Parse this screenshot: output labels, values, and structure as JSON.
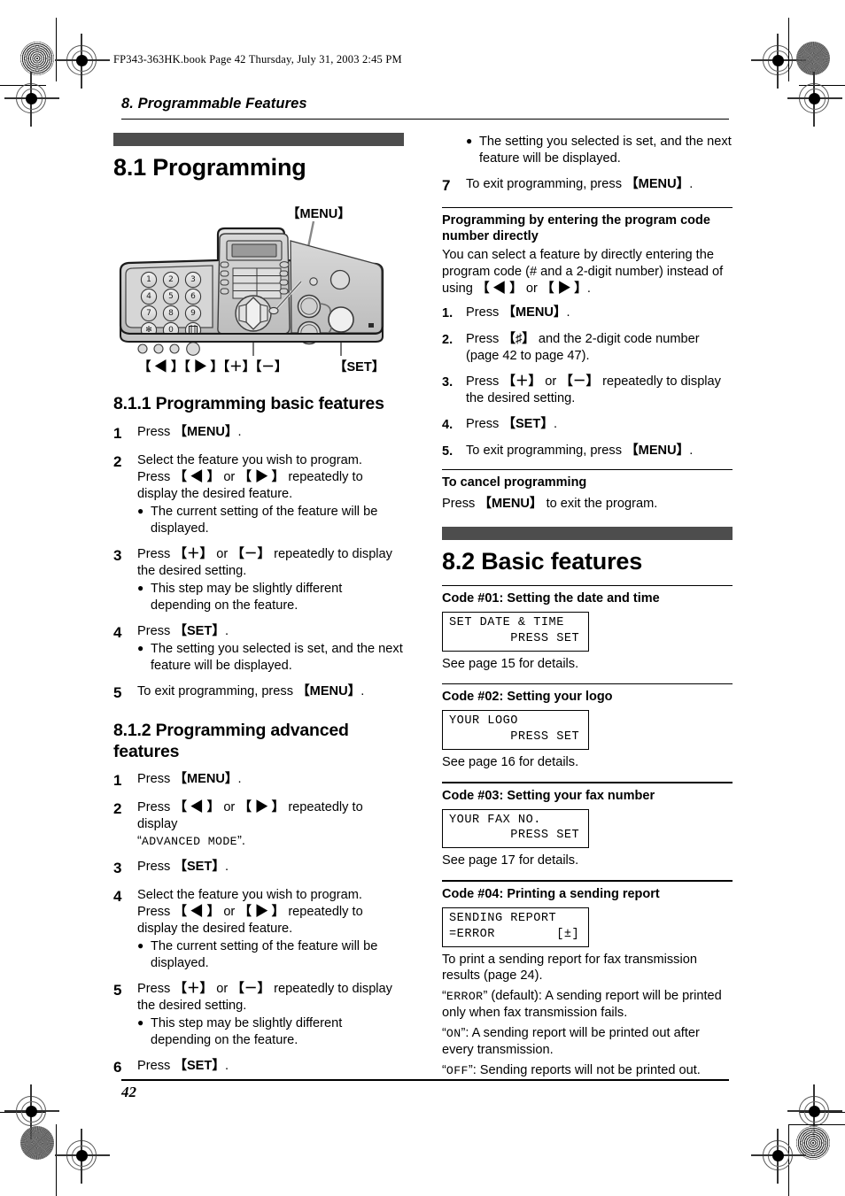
{
  "print_marks": {
    "note": "registration crosshairs and halftone dots"
  },
  "book_line": "FP343-363HK.book  Page 42  Thursday, July 31, 2003  2:45 PM",
  "running_head": "8. Programmable Features",
  "folio": "42",
  "left_column": {
    "section_title": "8.1 Programming",
    "figure": {
      "callout_menu": "【MENU】",
      "callout_nav": "【 ◀ 】【 ▶ 】【＋】【－】",
      "callout_set": "【SET】"
    },
    "subsection1": {
      "title": "8.1.1 Programming basic features",
      "steps": [
        {
          "num": "1",
          "text_parts": [
            "Press ",
            "【MENU】",
            "."
          ]
        },
        {
          "num": "2",
          "line1": "Select the feature you wish to program.",
          "line2_parts": [
            "Press ",
            "【 ◀ 】",
            " or ",
            "【 ▶ 】",
            " repeatedly to display the desired feature."
          ],
          "bullets": [
            "The current setting of the feature will be displayed."
          ]
        },
        {
          "num": "3",
          "line_parts": [
            "Press ",
            "【＋】",
            " or ",
            "【－】",
            " repeatedly to display the desired setting."
          ],
          "bullets": [
            "This step may be slightly different depending on the feature."
          ]
        },
        {
          "num": "4",
          "text_parts": [
            "Press ",
            "【SET】",
            "."
          ],
          "bullets": [
            "The setting you selected is set, and the next feature will be displayed."
          ]
        },
        {
          "num": "5",
          "text_parts": [
            "To exit programming, press ",
            "【MENU】",
            "."
          ]
        }
      ]
    },
    "subsection2": {
      "title": "8.1.2 Programming advanced features",
      "steps": [
        {
          "num": "1",
          "text_parts": [
            "Press ",
            "【MENU】",
            "."
          ]
        },
        {
          "num": "2",
          "line_parts": [
            "Press ",
            "【 ◀ 】",
            " or ",
            "【 ▶ 】",
            " repeatedly to display "
          ],
          "lcd_word": "ADVANCED MODE"
        },
        {
          "num": "3",
          "text_parts": [
            "Press ",
            "【SET】",
            "."
          ]
        },
        {
          "num": "4",
          "line1": "Select the feature you wish to program.",
          "line2_parts": [
            "Press ",
            "【 ◀ 】",
            " or ",
            "【 ▶ 】",
            " repeatedly to display the desired feature."
          ],
          "bullets": [
            "The current setting of the feature will be displayed."
          ]
        },
        {
          "num": "5",
          "line_parts": [
            "Press ",
            "【＋】",
            " or ",
            "【－】",
            " repeatedly to display the desired setting."
          ],
          "bullets": [
            "This step may be slightly different depending on the feature."
          ]
        },
        {
          "num": "6",
          "text_parts": [
            "Press ",
            "【SET】",
            "."
          ]
        }
      ]
    }
  },
  "right_column": {
    "top_bullet": "The setting you selected is set, and the next feature will be displayed.",
    "step7": {
      "num": "7",
      "text_parts": [
        "To exit programming, press ",
        "【MENU】",
        "."
      ]
    },
    "direct_entry": {
      "title": "Programming by entering the program code number directly",
      "intro_parts": [
        "You can select a feature by directly entering the program code (# and a 2-digit number) instead of using ",
        "【 ◀ 】",
        " or ",
        "【 ▶ 】",
        "."
      ],
      "steps": [
        {
          "num": "1.",
          "parts": [
            "Press ",
            "【MENU】",
            "."
          ]
        },
        {
          "num": "2.",
          "parts": [
            "Press ",
            "【♯】",
            " and the 2-digit code number (page 42 to page 47)."
          ]
        },
        {
          "num": "3.",
          "parts": [
            "Press ",
            "【＋】",
            " or ",
            "【－】",
            " repeatedly to display the desired setting."
          ]
        },
        {
          "num": "4.",
          "parts": [
            "Press ",
            "【SET】",
            "."
          ]
        },
        {
          "num": "5.",
          "parts": [
            "To exit programming, press ",
            "【MENU】",
            "."
          ]
        }
      ]
    },
    "cancel": {
      "title": "To cancel programming",
      "text_parts": [
        "Press ",
        "【MENU】",
        " to exit the program."
      ]
    },
    "section_title": "8.2 Basic features",
    "codes": [
      {
        "heading": "Code #01: Setting the date and time",
        "lcd": "SET DATE & TIME\n        PRESS SET",
        "note": "See page 15 for details."
      },
      {
        "heading": "Code #02: Setting your logo",
        "lcd": "YOUR LOGO\n        PRESS SET",
        "note": "See page 16 for details."
      },
      {
        "heading": "Code #03: Setting your fax number",
        "lcd": "YOUR FAX NO.\n        PRESS SET",
        "note": "See page 17 for details."
      },
      {
        "heading": "Code #04: Printing a sending report",
        "lcd": "SENDING REPORT\n=ERROR        [±]",
        "desc1": "To print a sending report for fax transmission results (page 24).",
        "opt1_word": "ERROR",
        "opt1_rest": "” (default): A sending report will be printed only when fax transmission fails.",
        "opt2_word": "ON",
        "opt2_rest": "”: A sending report will be printed out after every transmission.",
        "opt3_word": "OFF",
        "opt3_rest": "”: Sending reports will not be printed out."
      }
    ]
  },
  "colors": {
    "graybar": "#4d4d4d",
    "text": "#000000",
    "page": "#ffffff"
  }
}
